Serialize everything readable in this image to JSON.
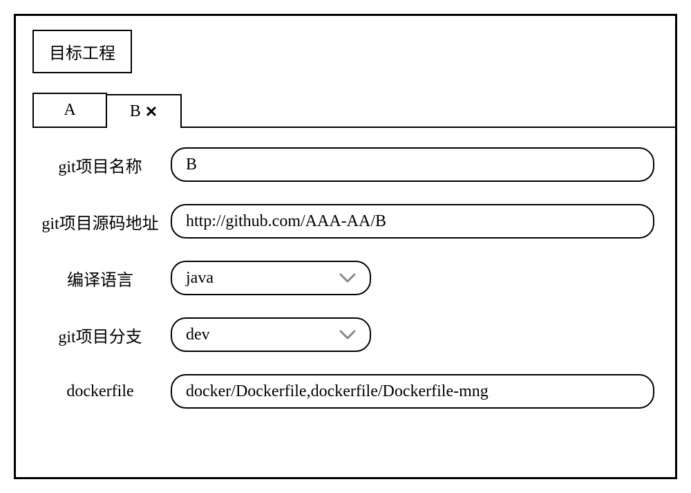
{
  "title": "目标工程",
  "tabs": [
    {
      "label": "A",
      "active": false
    },
    {
      "label": "B",
      "active": true
    }
  ],
  "form": {
    "git_name": {
      "label": "git项目名称",
      "value": "B"
    },
    "git_source": {
      "label": "git项目源码地址",
      "value": "http://github.com/AAA-AA/B"
    },
    "language": {
      "label": "编译语言",
      "value": "java"
    },
    "git_branch": {
      "label": "git项目分支",
      "value": "dev"
    },
    "dockerfile": {
      "label": "dockerfile",
      "value": "docker/Dockerfile,dockerfile/Dockerfile-mng"
    }
  }
}
